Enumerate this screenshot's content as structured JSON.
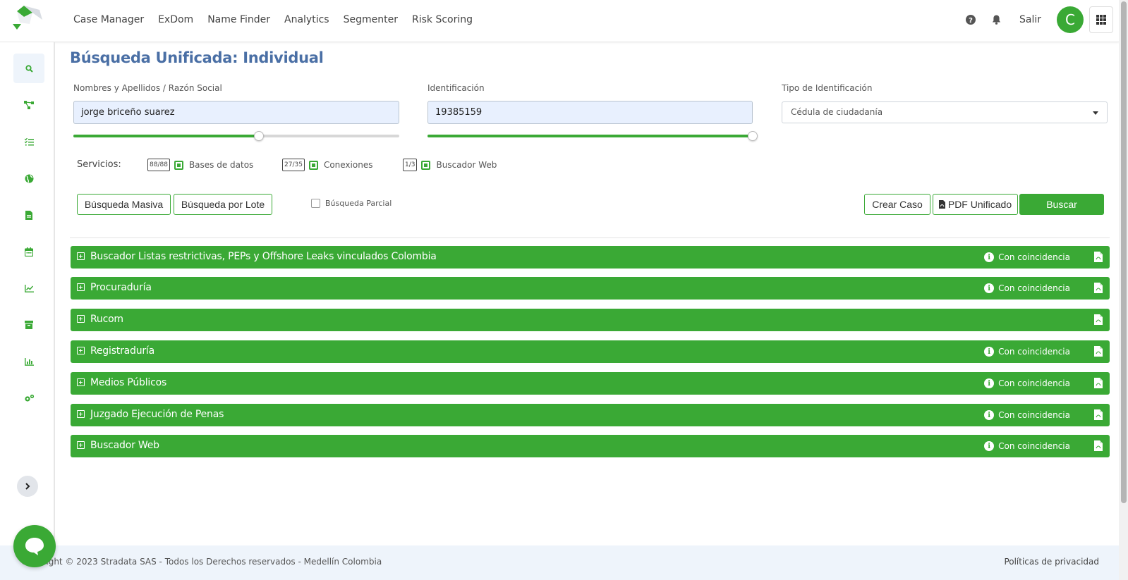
{
  "nav": {
    "items": [
      "Case Manager",
      "ExDom",
      "Name Finder",
      "Analytics",
      "Segmenter",
      "Risk Scoring"
    ],
    "salir": "Salir",
    "avatar_initial": "C"
  },
  "page": {
    "title": "Búsqueda Unificada: Individual"
  },
  "form": {
    "name_label": "Nombres y Apellidos / Razón Social",
    "name_value": "jorge briceño suarez",
    "name_slider_level": 0.57,
    "id_label": "Identificación",
    "id_value": "19385159",
    "id_slider_level": 1.0,
    "type_label": "Tipo de Identificación",
    "type_value": "Cédula de ciudadanía"
  },
  "services": {
    "label": "Servicios:",
    "items": [
      {
        "count": "88/88",
        "label": "Bases de datos",
        "checked": true
      },
      {
        "count": "27/35",
        "label": "Conexiones",
        "checked": true
      },
      {
        "count": "1/3",
        "label": "Buscador Web",
        "checked": true
      }
    ]
  },
  "actions": {
    "bulk_search": "Búsqueda Masiva",
    "batch_search": "Búsqueda por Lote",
    "partial_search": "Búsqueda Parcial",
    "create_case": "Crear Caso",
    "unified_pdf": "PDF Unificado",
    "search": "Buscar"
  },
  "results": [
    {
      "title": "Buscador Listas restrictivas, PEPs y Offshore Leaks vinculados Colombia",
      "status": "Con coincidencia"
    },
    {
      "title": "Procuraduría",
      "status": "Con coincidencia"
    },
    {
      "title": "Rucom",
      "status": ""
    },
    {
      "title": "Registraduría",
      "status": "Con coincidencia"
    },
    {
      "title": "Medios Públicos",
      "status": "Con coincidencia"
    },
    {
      "title": "Juzgado Ejecución de Penas",
      "status": "Con coincidencia"
    },
    {
      "title": "Buscador Web",
      "status": "Con coincidencia"
    }
  ],
  "footer": {
    "copyright": "Copyright © 2023 Stradata SAS - Todos los Derechos reservados - Medellín Colombia",
    "privacy": "Políticas de privacidad"
  },
  "colors": {
    "brand_green": "#3aa935",
    "title_blue": "#4a6fa5"
  },
  "icons": {
    "sidebar": [
      "search-icon",
      "network-icon",
      "checklist-icon",
      "globe-icon",
      "document-icon",
      "calendar-icon",
      "line-chart-icon",
      "archive-icon",
      "bar-chart-icon",
      "settings-icon"
    ]
  }
}
